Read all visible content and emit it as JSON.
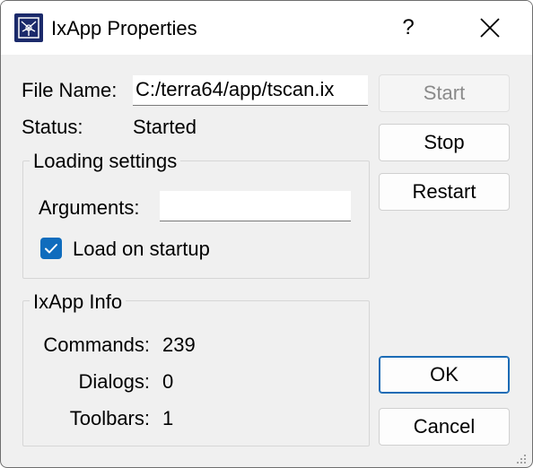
{
  "window": {
    "title": "IxApp Properties",
    "help_label": "?",
    "app_icon": "ixapp-icon",
    "close_icon": "close-icon"
  },
  "form": {
    "file_name_label": "File Name:",
    "file_name_value": "C:/terra64/app/tscan.ix",
    "status_label": "Status:",
    "status_value": "Started"
  },
  "loading_settings": {
    "title": "Loading settings",
    "arguments_label": "Arguments:",
    "arguments_value": "",
    "load_on_startup_label": "Load on startup",
    "load_on_startup_checked": true
  },
  "ixapp_info": {
    "title": "IxApp Info",
    "commands_label": "Commands:",
    "commands_value": "239",
    "dialogs_label": "Dialogs:",
    "dialogs_value": "0",
    "toolbars_label": "Toolbars:",
    "toolbars_value": "1"
  },
  "buttons": {
    "start": "Start",
    "stop": "Stop",
    "restart": "Restart",
    "ok": "OK",
    "cancel": "Cancel"
  },
  "colors": {
    "accent": "#0f6cbd",
    "default_button_border": "#1a6bb5",
    "disabled_text": "#8a8a8a",
    "dialog_bg": "#f0f0f0"
  }
}
